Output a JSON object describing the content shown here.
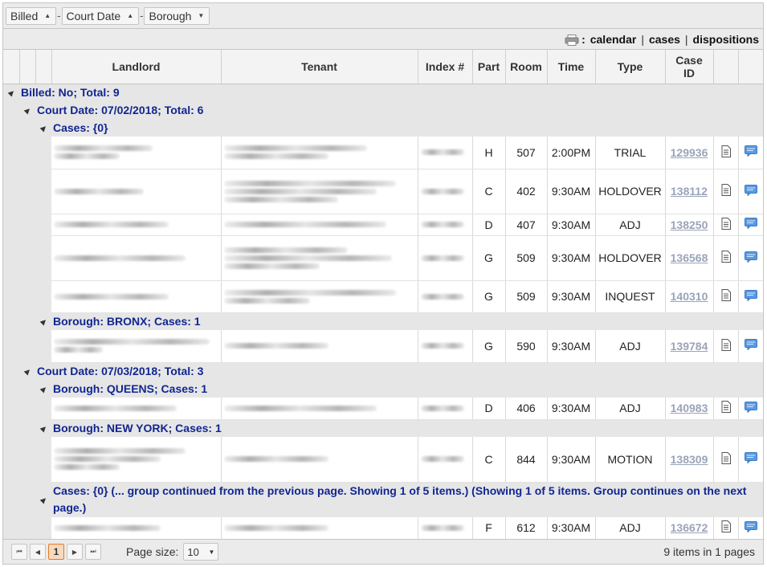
{
  "group_panel": {
    "chips": [
      {
        "label": "Billed",
        "sort": "▲"
      },
      {
        "label": "Court Date",
        "sort": "▲"
      },
      {
        "label": "Borough",
        "sort": "▼"
      }
    ],
    "separator": "-"
  },
  "toolbar": {
    "colon": ":",
    "links": [
      "calendar",
      "cases",
      "dispositions"
    ],
    "divider": "|"
  },
  "columns": {
    "landlord": "Landlord",
    "tenant": "Tenant",
    "index": "Index #",
    "part": "Part",
    "room": "Room",
    "time": "Time",
    "type": "Type",
    "caseid": "Case ID"
  },
  "groups": {
    "billed_no": "Billed: No; Total: 9",
    "date1": "Court Date: 07/02/2018; Total: 6",
    "cases1": "Cases: {0}",
    "bronx": "Borough: BRONX; Cases: 1",
    "date2": "Court Date: 07/03/2018; Total: 3",
    "queens": "Borough: QUEENS; Cases: 1",
    "newyork": "Borough: NEW YORK; Cases: 1",
    "cases2": "Cases: {0} (... group continued from the previous page. Showing 1 of 5 items.) (Showing 1 of 5 items. Group continues on the next page.)"
  },
  "rows": [
    {
      "part": "H",
      "room": "507",
      "time": "2:00PM",
      "type": "TRIAL",
      "caseid": "129936"
    },
    {
      "part": "C",
      "room": "402",
      "time": "9:30AM",
      "type": "HOLDOVER",
      "caseid": "138112"
    },
    {
      "part": "D",
      "room": "407",
      "time": "9:30AM",
      "type": "ADJ",
      "caseid": "138250"
    },
    {
      "part": "G",
      "room": "509",
      "time": "9:30AM",
      "type": "HOLDOVER",
      "caseid": "136568"
    },
    {
      "part": "G",
      "room": "509",
      "time": "9:30AM",
      "type": "INQUEST",
      "caseid": "140310"
    },
    {
      "part": "G",
      "room": "590",
      "time": "9:30AM",
      "type": "ADJ",
      "caseid": "139784"
    },
    {
      "part": "D",
      "room": "406",
      "time": "9:30AM",
      "type": "ADJ",
      "caseid": "140983"
    },
    {
      "part": "C",
      "room": "844",
      "time": "9:30AM",
      "type": "MOTION",
      "caseid": "138309"
    },
    {
      "part": "F",
      "room": "612",
      "time": "9:30AM",
      "type": "ADJ",
      "caseid": "136672"
    }
  ],
  "pager": {
    "first": "⏮",
    "prev": "◀",
    "current": "1",
    "next": "▶",
    "last": "⏭",
    "page_size_label": "Page size:",
    "page_size_value": "10",
    "info": "9 items in 1 pages"
  },
  "colors": {
    "group_text": "#102690",
    "case_link": "#9aa4b8",
    "chat_icon": "#4a90d9"
  }
}
